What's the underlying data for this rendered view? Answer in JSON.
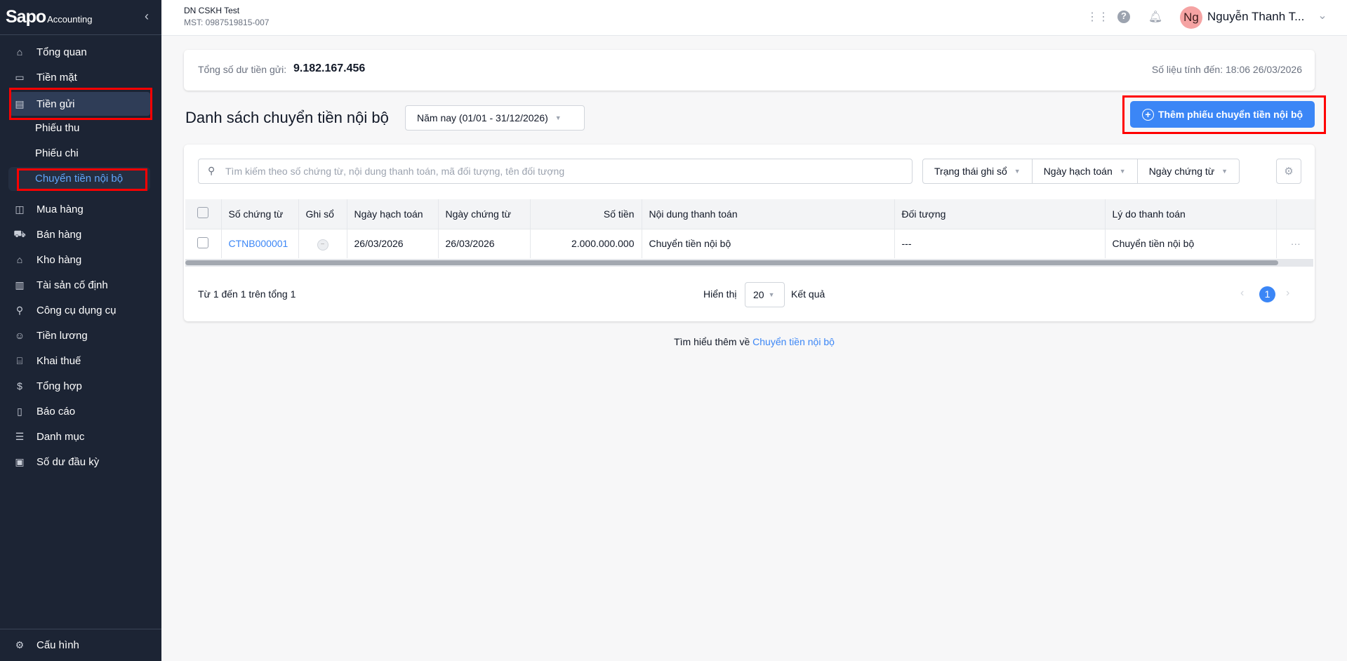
{
  "sidebar": {
    "brand": "Sapo",
    "brand_sub": "Accounting",
    "items": [
      {
        "label": "Tổng quan",
        "icon": "home-icon"
      },
      {
        "label": "Tiền mặt",
        "icon": "cash-icon"
      },
      {
        "label": "Tiền gửi",
        "icon": "card-icon"
      },
      {
        "label": "Mua hàng",
        "icon": "bag-icon"
      },
      {
        "label": "Bán hàng",
        "icon": "cart-icon"
      },
      {
        "label": "Kho hàng",
        "icon": "warehouse-icon"
      },
      {
        "label": "Tài sản cố định",
        "icon": "building-icon"
      },
      {
        "label": "Công cụ dụng cụ",
        "icon": "tool-icon"
      },
      {
        "label": "Tiền lương",
        "icon": "salary-icon"
      },
      {
        "label": "Khai thuế",
        "icon": "bank-icon"
      },
      {
        "label": "Tổng hợp",
        "icon": "ledger-icon"
      },
      {
        "label": "Báo cáo",
        "icon": "report-icon"
      },
      {
        "label": "Danh mục",
        "icon": "list-icon"
      },
      {
        "label": "Số dư đầu kỳ",
        "icon": "wallet-icon"
      }
    ],
    "sub_items": [
      "Phiếu thu",
      "Phiếu chi",
      "Chuyển tiền nội bộ"
    ],
    "settings": "Cấu hình"
  },
  "header": {
    "company": "DN CSKH Test",
    "tax_id": "MST: 0987519815-007",
    "avatar": "Ng",
    "user": "Nguyễn Thanh T..."
  },
  "summary": {
    "label": "Tổng số dư tiền gửi:",
    "value": "9.182.167.456",
    "as_of": "Số liệu tính đến: 18:06 26/03/2026"
  },
  "page": {
    "title": "Danh sách chuyển tiền nội bộ",
    "date_range": "Năm nay (01/01 - 31/12/2026)",
    "add_button": "Thêm phiếu chuyển tiền nội bộ"
  },
  "filters": {
    "search_placeholder": "Tìm kiếm theo số chứng từ, nội dung thanh toán, mã đối tượng, tên đối tượng",
    "status": "Trạng thái ghi sổ",
    "posting_date": "Ngày hạch toán",
    "doc_date": "Ngày chứng từ"
  },
  "table": {
    "columns": [
      "Số chứng từ",
      "Ghi sổ",
      "Ngày hạch toán",
      "Ngày chứng từ",
      "Số tiền",
      "Nội dung thanh toán",
      "Đối tượng",
      "Lý do thanh toán"
    ],
    "rows": [
      {
        "doc_no": "CTNB000001",
        "posting_date": "26/03/2026",
        "doc_date": "26/03/2026",
        "amount": "2.000.000.000",
        "content": "Chuyển tiền nội bộ",
        "object": "---",
        "reason": "Chuyển tiền nội bộ"
      }
    ]
  },
  "pagination": {
    "summary": "Từ 1 đến 1 trên tổng 1",
    "show_label": "Hiển thị",
    "page_size": "20",
    "result_label": "Kết quả",
    "current_page": "1"
  },
  "footer": {
    "learn_more": "Tìm hiểu thêm về",
    "learn_link": "Chuyển tiền nội bộ"
  }
}
